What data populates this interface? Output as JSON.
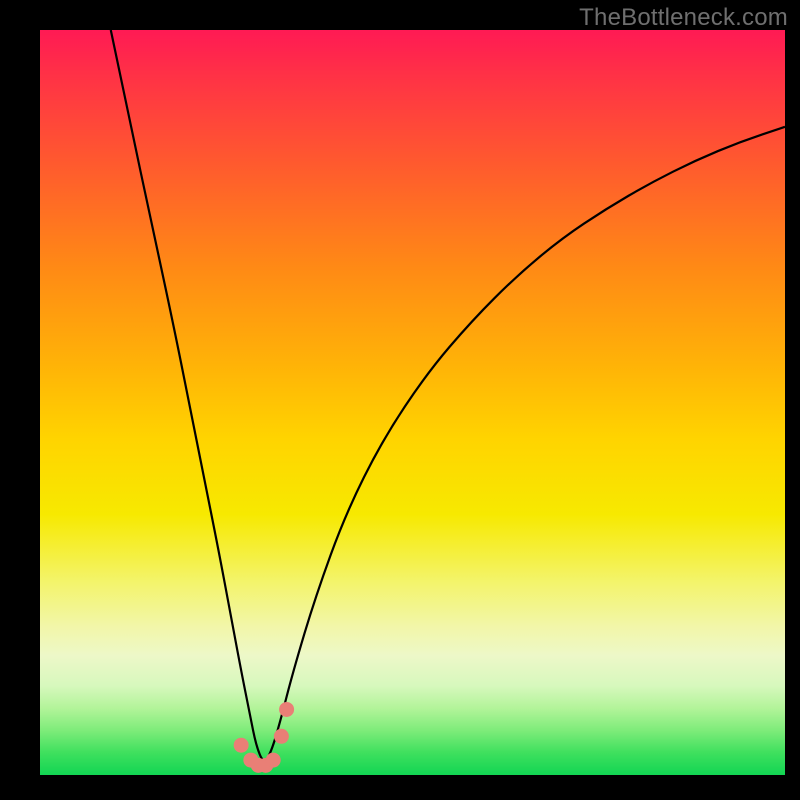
{
  "watermark": {
    "text": "TheBottleneck.com"
  },
  "colors": {
    "page_bg": "#000000",
    "curve_stroke": "#000000",
    "marker_fill": "#e97f76",
    "marker_stroke": "#d86a61"
  },
  "chart_data": {
    "type": "line",
    "title": "",
    "xlabel": "",
    "ylabel": "",
    "xlim": [
      0,
      100
    ],
    "ylim": [
      0,
      100
    ],
    "grid": false,
    "legend": false,
    "series": [
      {
        "name": "bottleneck-curve",
        "x": [
          9.5,
          12,
          15,
          18,
          20,
          22,
          24,
          25.5,
          27,
          28.2,
          29,
          30,
          31,
          32.2,
          34,
          37,
          41,
          46,
          52,
          58,
          64,
          70,
          76,
          82,
          88,
          94,
          100
        ],
        "y": [
          100,
          88,
          74,
          60,
          50,
          40,
          30,
          22,
          14,
          8,
          4,
          1.5,
          3,
          7,
          14,
          24,
          35,
          45,
          54,
          61,
          67,
          72,
          76,
          79.5,
          82.5,
          85,
          87
        ]
      }
    ],
    "markers": [
      {
        "x": 27.0,
        "y": 4.0
      },
      {
        "x": 28.3,
        "y": 2.0
      },
      {
        "x": 29.3,
        "y": 1.3
      },
      {
        "x": 30.3,
        "y": 1.3
      },
      {
        "x": 31.3,
        "y": 2.0
      },
      {
        "x": 32.4,
        "y": 5.2
      },
      {
        "x": 33.1,
        "y": 8.8
      }
    ]
  }
}
